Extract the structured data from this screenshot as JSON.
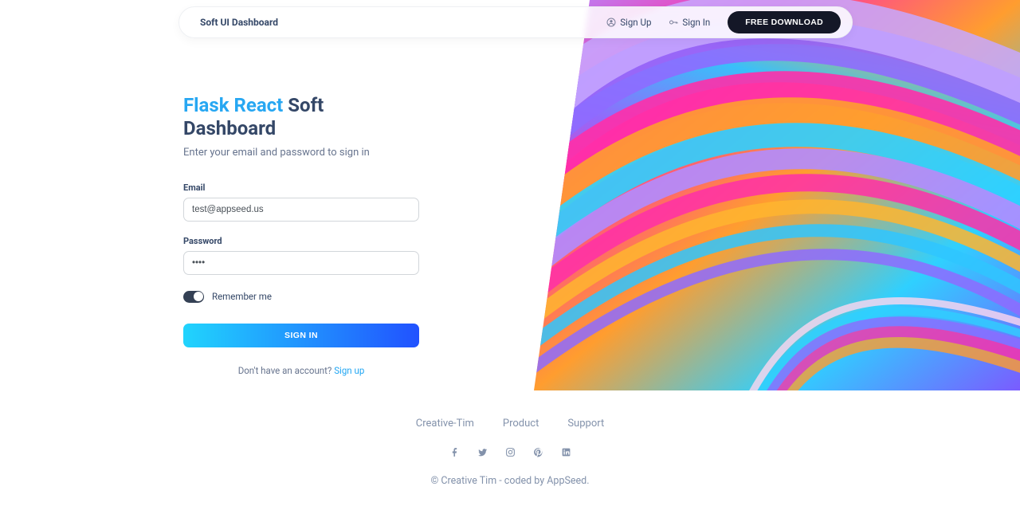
{
  "nav": {
    "brand": "Soft UI Dashboard",
    "signup_label": "Sign Up",
    "signin_label": "Sign In",
    "cta_label": "FREE DOWNLOAD"
  },
  "form": {
    "title_accent": "Flask React",
    "title_dark": " Soft Dashboard",
    "subtitle": "Enter your email and password to sign in",
    "email_label": "Email",
    "email_value": "test@appseed.us",
    "password_label": "Password",
    "password_value": "pass",
    "remember_label": "Remember me",
    "submit_label": "SIGN IN",
    "no_account_text": "Don't have an account? ",
    "signup_link": "Sign up"
  },
  "footer": {
    "links": [
      "Creative-Tim",
      "Product",
      "Support"
    ],
    "copyright": "© Creative Tim - coded by AppSeed."
  }
}
